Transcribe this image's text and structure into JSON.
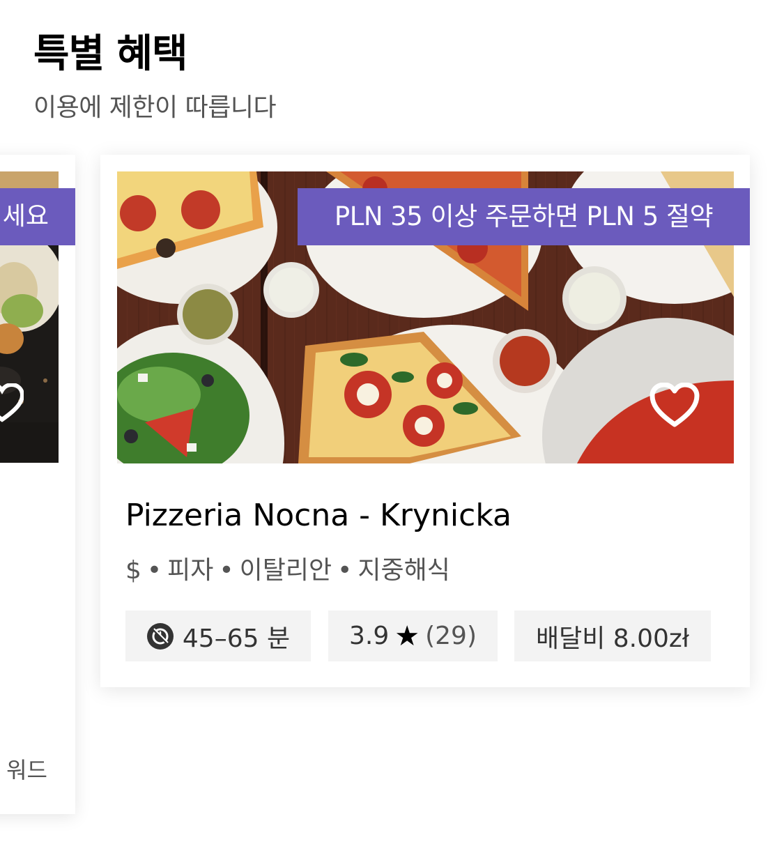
{
  "section": {
    "title": "특별 혜택",
    "subtitle": "이용에 제한이 따릅니다"
  },
  "partial_card": {
    "promo_fragment": "세요",
    "footer_fragment": "워드"
  },
  "store_card": {
    "promo": "PLN 35 이상 주문하면 PLN 5 절약",
    "name": "Pizzeria Nocna - Krynicka",
    "price_level": "$",
    "categories": [
      "피자",
      "이탈리안",
      "지중해식"
    ],
    "separator": "•",
    "delivery_time": "45–65 분",
    "rating": "3.9",
    "rating_count": "(29)",
    "delivery_fee": "배달비 8.00zł",
    "icons": {
      "delivery_time": "clock-icon",
      "rating": "star-icon",
      "favorite": "heart-icon"
    }
  },
  "colors": {
    "promo_bg": "#6b5bbd",
    "pill_bg": "#f3f3f3"
  }
}
